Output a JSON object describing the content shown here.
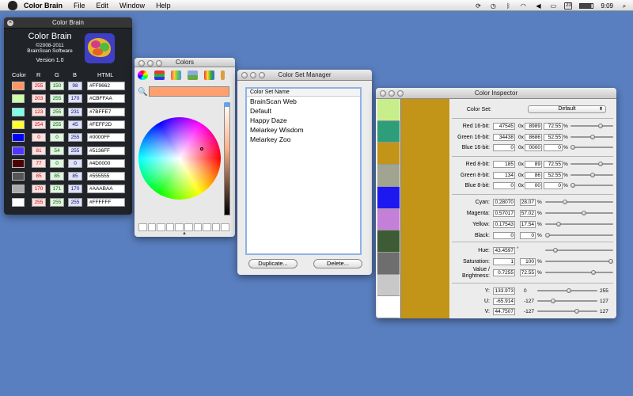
{
  "menubar": {
    "app": "Color Brain",
    "items": [
      "File",
      "Edit",
      "Window",
      "Help"
    ],
    "battery": "100%",
    "time": "9:09",
    "calendar_day": "23"
  },
  "color_brain": {
    "window_title": "Color Brain",
    "title": "Color Brain",
    "copyright": "©2008-2011",
    "company": "BrainScan Software",
    "version": "Version 1.0",
    "headers": [
      "Color",
      "R",
      "G",
      "B",
      "HTML"
    ],
    "rows": [
      {
        "hex": "#FF9662",
        "r": "255",
        "g": "150",
        "b": "98"
      },
      {
        "hex": "#CBFFAA",
        "r": "203",
        "g": "255",
        "b": "170"
      },
      {
        "hex": "#7BFFE7",
        "r": "123",
        "g": "255",
        "b": "231"
      },
      {
        "hex": "#FEFF2D",
        "r": "254",
        "g": "255",
        "b": "45"
      },
      {
        "hex": "#0000FF",
        "r": "0",
        "g": "0",
        "b": "255"
      },
      {
        "hex": "#5136FF",
        "r": "81",
        "g": "54",
        "b": "255"
      },
      {
        "hex": "#4D0000",
        "r": "77",
        "g": "0",
        "b": "0"
      },
      {
        "hex": "#555555",
        "r": "85",
        "g": "85",
        "b": "85"
      },
      {
        "hex": "#AAABAA",
        "r": "170",
        "g": "171",
        "b": "170"
      },
      {
        "hex": "#FFFFFF",
        "r": "255",
        "g": "255",
        "b": "255"
      }
    ]
  },
  "colors_panel": {
    "title": "Colors",
    "current_color": "#FFA070"
  },
  "color_set_manager": {
    "title": "Color Set Manager",
    "column_header": "Color Set Name",
    "sets": [
      "BrainScan Web",
      "Default",
      "Happy Daze",
      "Melarkey Wisdom",
      "Melarkey Zoo"
    ],
    "duplicate_label": "Duplicate...",
    "delete_label": "Delete..."
  },
  "color_inspector": {
    "title": "Color Inspector",
    "color_set_label": "Color Set:",
    "color_set_value": "Default",
    "current_color": "#C29417",
    "swatches": [
      "#C8EE8C",
      "#2E9E7A",
      "#C29417",
      "#A0A490",
      "#1E18F0",
      "#C47FD8",
      "#3D5C36",
      "#6E6E6E",
      "#C8C8C8",
      "#FFFFFF"
    ],
    "rows_16": [
      {
        "label": "Red 16-bit:",
        "dec": "47545",
        "hex": "8989",
        "pct": "72.55",
        "fraction": 0.7255
      },
      {
        "label": "Green 16-bit:",
        "dec": "34438",
        "hex": "8686",
        "pct": "52.55",
        "fraction": 0.5255
      },
      {
        "label": "Blue 16-bit:",
        "dec": "0",
        "hex": "0000",
        "pct": "0",
        "fraction": 0
      }
    ],
    "rows_8": [
      {
        "label": "Red 8-bit:",
        "dec": "185",
        "hex": "89",
        "pct": "72.55",
        "fraction": 0.7255
      },
      {
        "label": "Green 8-bit:",
        "dec": "134",
        "hex": "86",
        "pct": "52.55",
        "fraction": 0.5255
      },
      {
        "label": "Blue 8-bit:",
        "dec": "0",
        "hex": "00",
        "pct": "0",
        "fraction": 0
      }
    ],
    "hex_prefix": "0x",
    "pct_sign": "%",
    "cmyk": [
      {
        "label": "Cyan:",
        "val": "0.28070",
        "pct": "28.07",
        "fraction": 0.2807
      },
      {
        "label": "Magenta:",
        "val": "0.57017",
        "pct": "57.02",
        "fraction": 0.5702
      },
      {
        "label": "Yellow:",
        "val": "0.17543",
        "pct": "17.54",
        "fraction": 0.1754
      },
      {
        "label": "Black:",
        "val": "0",
        "pct": "0",
        "fraction": 0
      }
    ],
    "hue": {
      "label": "Hue:",
      "val": "43.4597",
      "deg": "°",
      "fraction": 0.1207
    },
    "saturation": {
      "label": "Saturation:",
      "val": "1",
      "pct": "100",
      "fraction": 1
    },
    "value": {
      "label": "Value / Brightness:",
      "val": "0.7255",
      "pct": "72.55",
      "fraction": 0.7255
    },
    "yuv": [
      {
        "label": "Y:",
        "val": "133.973",
        "min": "0",
        "max": "255",
        "fraction": 0.525
      },
      {
        "label": "U:",
        "val": "-65.914",
        "min": "-127",
        "max": "127",
        "fraction": 0.24
      },
      {
        "label": "V:",
        "val": "44.7507",
        "min": "-127",
        "max": "127",
        "fraction": 0.676
      }
    ]
  }
}
